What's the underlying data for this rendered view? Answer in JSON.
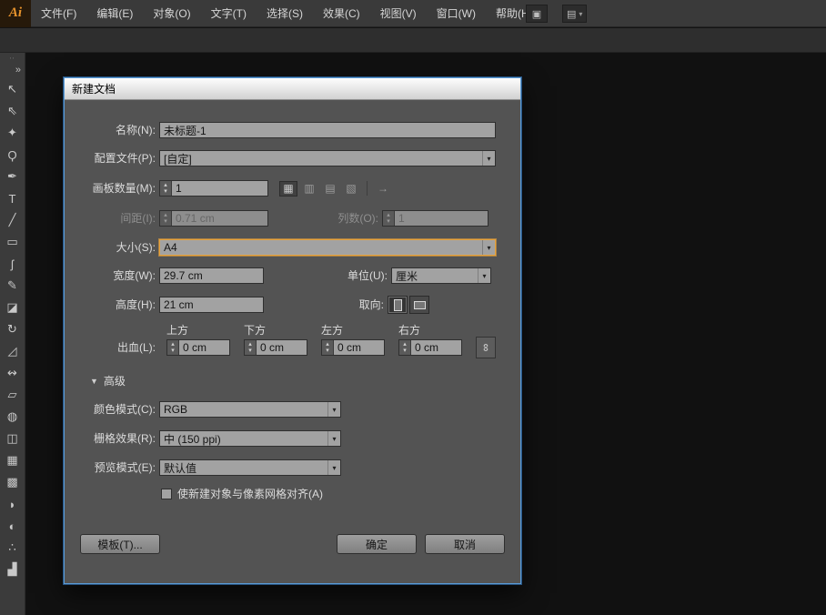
{
  "colors": {
    "accent": "#e8a33d",
    "dialog_focus_border": "#5b9bd5"
  },
  "menubar": {
    "logo": "Ai",
    "items": [
      "文件(F)",
      "编辑(E)",
      "对象(O)",
      "文字(T)",
      "选择(S)",
      "效果(C)",
      "视图(V)",
      "窗口(W)",
      "帮助(H)"
    ]
  },
  "toolbar": {
    "collapse": "»",
    "drag_dots": "∙∙",
    "tools": [
      {
        "name": "selection-tool",
        "glyph": "↖"
      },
      {
        "name": "direct-selection-tool",
        "glyph": "⇖"
      },
      {
        "name": "magic-wand-tool",
        "glyph": "✦"
      },
      {
        "name": "lasso-tool",
        "glyph": "Ϙ"
      },
      {
        "name": "pen-tool",
        "glyph": "✒"
      },
      {
        "name": "type-tool",
        "glyph": "T"
      },
      {
        "name": "line-segment-tool",
        "glyph": "╱"
      },
      {
        "name": "rectangle-tool",
        "glyph": "▭"
      },
      {
        "name": "paintbrush-tool",
        "glyph": "ʃ"
      },
      {
        "name": "pencil-tool",
        "glyph": "✎"
      },
      {
        "name": "eraser-tool",
        "glyph": "◪"
      },
      {
        "name": "rotate-tool",
        "glyph": "↻"
      },
      {
        "name": "scale-tool",
        "glyph": "◿"
      },
      {
        "name": "width-tool",
        "glyph": "↭"
      },
      {
        "name": "free-transform-tool",
        "glyph": "▱"
      },
      {
        "name": "shape-builder-tool",
        "glyph": "◍"
      },
      {
        "name": "perspective-grid-tool",
        "glyph": "◫"
      },
      {
        "name": "mesh-tool",
        "glyph": "▦"
      },
      {
        "name": "gradient-tool",
        "glyph": "▩"
      },
      {
        "name": "eyedropper-tool",
        "glyph": "◗"
      },
      {
        "name": "blend-tool",
        "glyph": "◐"
      },
      {
        "name": "symbol-sprayer-tool",
        "glyph": "∴"
      },
      {
        "name": "column-graph-tool",
        "glyph": "▟"
      }
    ]
  },
  "dialog": {
    "title": "新建文档",
    "name_label": "名称(N):",
    "name_value": "未标题-1",
    "profile_label": "配置文件(P):",
    "profile_value": "[自定]",
    "artboards_label": "画板数量(M):",
    "artboards_value": "1",
    "spacing_label": "间距(I):",
    "spacing_value": "0.71 cm",
    "columns_label": "列数(O):",
    "columns_value": "1",
    "size_label": "大小(S):",
    "size_value": "A4",
    "width_label": "宽度(W):",
    "width_value": "29.7 cm",
    "units_label": "单位(U):",
    "units_value": "厘米",
    "height_label": "高度(H):",
    "height_value": "21 cm",
    "orientation_label": "取向:",
    "bleed_label": "出血(L):",
    "bleed_cols": [
      "上方",
      "下方",
      "左方",
      "右方"
    ],
    "bleed_values": [
      "0 cm",
      "0 cm",
      "0 cm",
      "0 cm"
    ],
    "advanced_label": "高级",
    "color_mode_label": "颜色模式(C):",
    "color_mode_value": "RGB",
    "raster_label": "栅格效果(R):",
    "raster_value": "中 (150 ppi)",
    "preview_label": "预览模式(E):",
    "preview_value": "默认值",
    "align_label": "使新建对象与像素网格对齐(A)",
    "align_checked": false,
    "template_button": "模板(T)...",
    "ok_button": "确定",
    "cancel_button": "取消"
  },
  "icons": {
    "caret_up": "▴",
    "caret_down": "▾",
    "dropdown": "▾",
    "expanded": "▼",
    "link": "∞",
    "bridge": "▣",
    "workspace": "▤",
    "grid_by_row": "▦",
    "grid_by_column": "▥",
    "arrange_by_row": "▤",
    "arrange_by_column": "▧",
    "rtl_arrow": "→"
  }
}
